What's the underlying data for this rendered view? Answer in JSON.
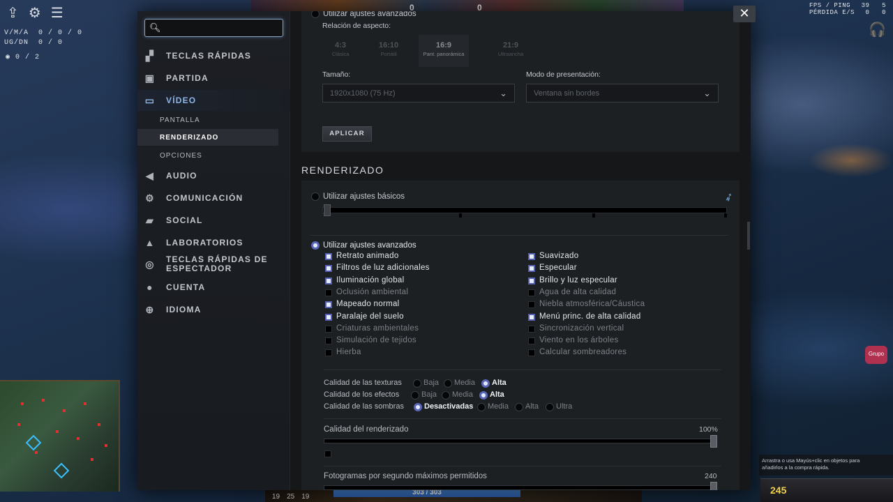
{
  "hud": {
    "kda_label": "V/M/A",
    "kda_value": "0 / 0 / 0",
    "ugdn_label": "UG/DN",
    "ugdn_value": "0 / 0",
    "wards": "0 / 2",
    "top_score_left": "0",
    "top_score_right": "0",
    "fps_label": "FPS / PING",
    "fps_val1": "39",
    "fps_val2": "5",
    "loss_label": "PÉRDIDA E/S",
    "loss_val1": "0",
    "loss_val2": "0",
    "health": "303 / 303",
    "level_nums": [
      "19",
      "25",
      "19"
    ],
    "shop_hint": "Arrastra o usa Mayús+clic en objetos para añadirlos a la compra rápida.",
    "gold": "245",
    "chat_label": "Grupo"
  },
  "search": {
    "placeholder": ""
  },
  "close_label": "✕",
  "sidebar": {
    "items": [
      {
        "label": "TECLAS RÁPIDAS",
        "icon": "hotkeys-icon"
      },
      {
        "label": "PARTIDA",
        "icon": "game-icon"
      },
      {
        "label": "VÍDEO",
        "icon": "monitor-icon"
      },
      {
        "label": "AUDIO",
        "icon": "speaker-icon"
      },
      {
        "label": "COMUNICACIÓN",
        "icon": "gear-icon"
      },
      {
        "label": "SOCIAL",
        "icon": "chat-icon"
      },
      {
        "label": "LABORATORIOS",
        "icon": "flask-icon"
      },
      {
        "label": "TECLAS RÁPIDAS DE\nESPECTADOR",
        "icon": "spectator-icon"
      },
      {
        "label": "CUENTA",
        "icon": "user-icon"
      },
      {
        "label": "IDIOMA",
        "icon": "globe-icon"
      }
    ],
    "video_sub": [
      "PANTALLA",
      "RENDERIZADO",
      "OPCIONES"
    ]
  },
  "display": {
    "advanced_label": "Utilizar ajustes avanzados",
    "aspect_label": "Relación de aspecto:",
    "aspects": [
      {
        "ratio": "4:3",
        "name": "Clásica"
      },
      {
        "ratio": "16:10",
        "name": "Portátil"
      },
      {
        "ratio": "16:9",
        "name": "Pant. panorámica"
      },
      {
        "ratio": "21:9",
        "name": "Ultraancha"
      }
    ],
    "size_label": "Tamaño:",
    "size_value": "1920x1080 (75 Hz)",
    "mode_label": "Modo de presentación:",
    "mode_value": "Ventana sin bordes",
    "apply_label": "APLICAR"
  },
  "render": {
    "title": "RENDERIZADO",
    "basic_label": "Utilizar ajustes básicos",
    "advanced_label": "Utilizar ajustes avanzados",
    "left_checks": [
      {
        "label": "Retrato animado",
        "on": true
      },
      {
        "label": "Filtros de luz adicionales",
        "on": true
      },
      {
        "label": "Iluminación global",
        "on": true
      },
      {
        "label": "Oclusión ambiental",
        "on": false
      },
      {
        "label": "Mapeado normal",
        "on": true
      },
      {
        "label": "Paralaje del suelo",
        "on": true
      },
      {
        "label": "Criaturas ambientales",
        "on": false
      },
      {
        "label": "Simulación de tejidos",
        "on": false
      },
      {
        "label": "Hierba",
        "on": false
      }
    ],
    "right_checks": [
      {
        "label": "Suavizado",
        "on": true
      },
      {
        "label": "Especular",
        "on": true
      },
      {
        "label": "Brillo y luz especular",
        "on": true
      },
      {
        "label": "Agua de alta calidad",
        "on": false
      },
      {
        "label": "Niebla atmosférica/Cáustica",
        "on": false
      },
      {
        "label": "Menú princ. de alta calidad",
        "on": true
      },
      {
        "label": "Sincronización vertical",
        "on": false
      },
      {
        "label": "Viento en los árboles",
        "on": false
      },
      {
        "label": "Calcular sombreadores",
        "on": false
      }
    ],
    "texture_label": "Calidad de las texturas",
    "texture_opts": [
      "Baja",
      "Media",
      "Alta"
    ],
    "texture_selected": 2,
    "effects_label": "Calidad de los efectos",
    "effects_opts": [
      "Baja",
      "Media",
      "Alta"
    ],
    "effects_selected": 2,
    "shadow_label": "Calidad de las sombras",
    "shadow_opts": [
      "Desactivadas",
      "Media",
      "Alta",
      "Ultra"
    ],
    "shadow_selected": 0,
    "render_quality_label": "Calidad del renderizado",
    "render_quality_value": "100%",
    "render_quality_fraction": 1.0,
    "fps_max_label": "Fotogramas por segundo máximos permitidos",
    "fps_max_value": "240"
  },
  "colors": {
    "accent": "#8fb6e8",
    "checkbox_on": "#5660b0"
  }
}
